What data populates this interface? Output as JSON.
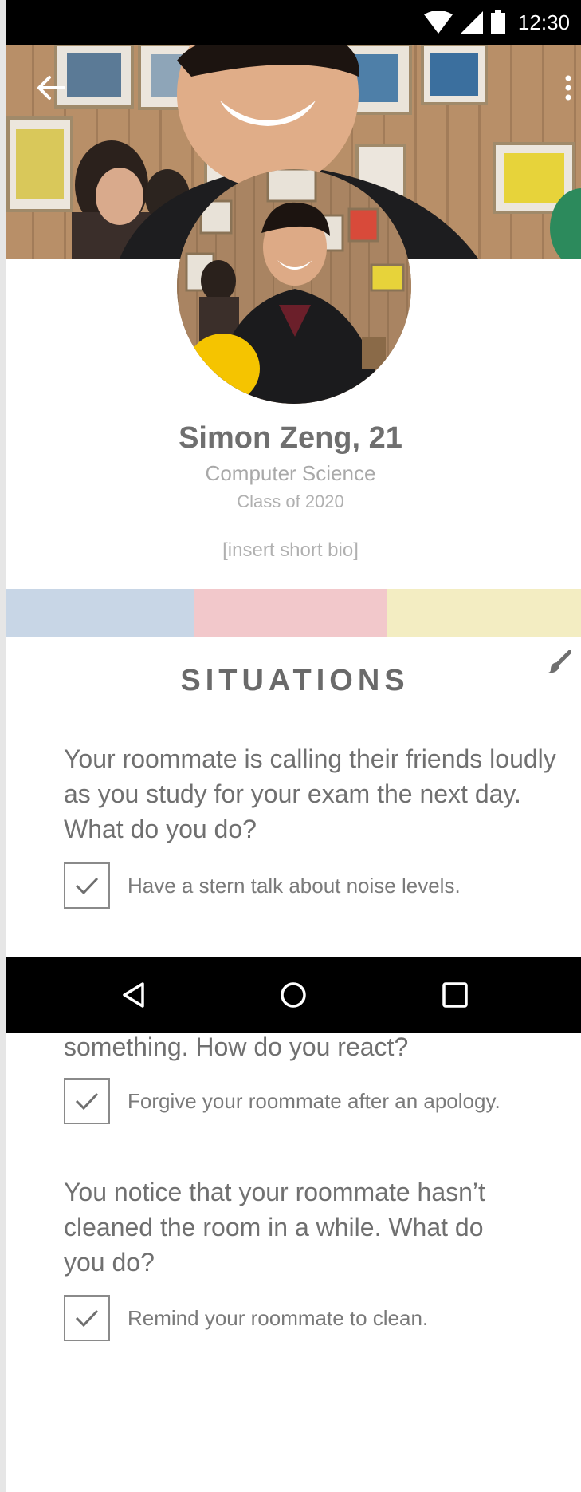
{
  "status_bar": {
    "time": "12:30",
    "icons": [
      "wifi-icon",
      "signal-icon",
      "battery-icon"
    ]
  },
  "header": {
    "back_icon": "arrow-left-icon",
    "more_icon": "more-vertical-icon"
  },
  "profile": {
    "name": "Simon Zeng, 21",
    "major": "Computer Science",
    "class_year": "Class of 2020",
    "bio": "[insert short bio]"
  },
  "palette": {
    "colors": [
      "#c8d6e6",
      "#f2c8cb",
      "#f3edc2"
    ]
  },
  "situations": {
    "title": "SITUATIONS",
    "edit_icon": "paintbrush-icon",
    "items": [
      {
        "question": "Your roommate is calling their friends loudly as you study for your exam the next day. What do you do?",
        "answer": "Have a stern talk about noise levels.",
        "checked": true
      },
      {
        "question": "something. How do you react?",
        "answer": "Forgive your roommate after an apology.",
        "checked": true
      },
      {
        "question": "You notice that your roommate hasn’t cleaned the room in a while. What do you do?",
        "answer": "Remind your roommate to clean.",
        "checked": true
      }
    ]
  },
  "nav_bar": {
    "icons": [
      "back-triangle-icon",
      "home-circle-icon",
      "recents-square-icon"
    ]
  }
}
